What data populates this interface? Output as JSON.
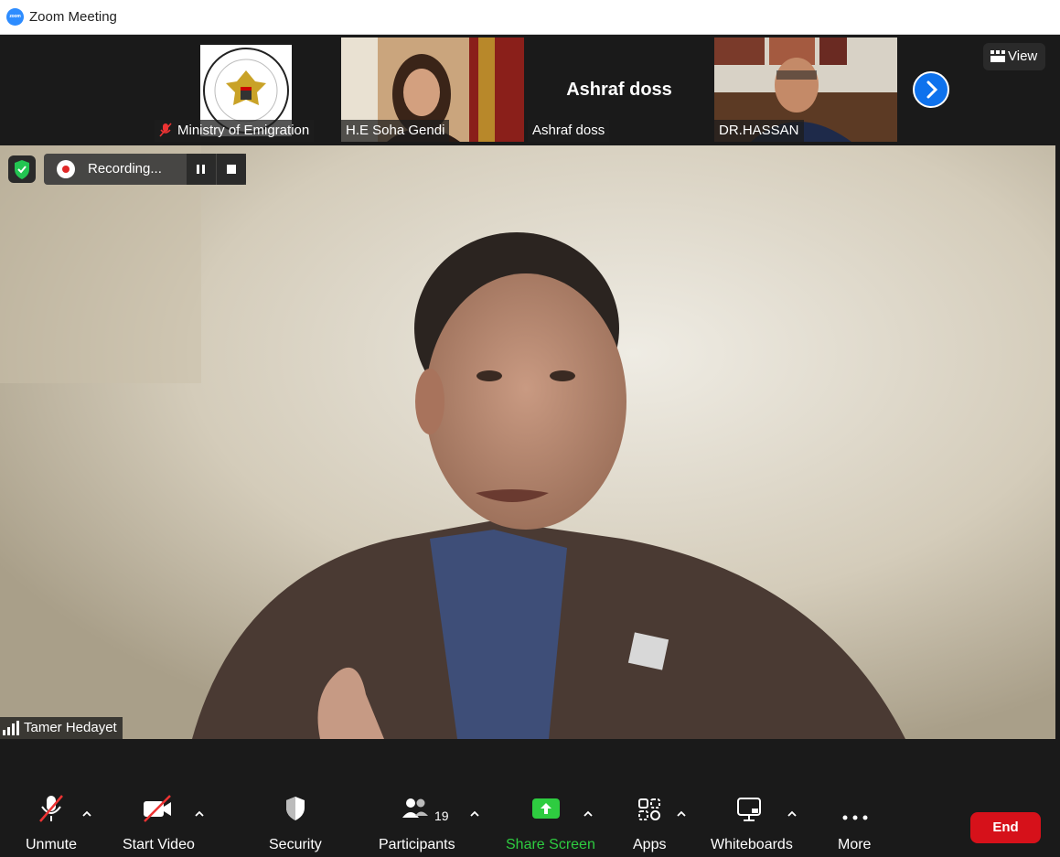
{
  "window": {
    "title": "Zoom Meeting",
    "logo_text": "zoom"
  },
  "top_bar": {
    "view_label": "View"
  },
  "participants_strip": [
    {
      "name": "Ministry of Emigration",
      "muted": true
    },
    {
      "name": "H.E Soha Gendi",
      "muted": false
    },
    {
      "name": "Ashraf doss",
      "display_name": "Ashraf doss",
      "muted": false
    },
    {
      "name": "DR.HASSAN",
      "muted": false
    }
  ],
  "recording": {
    "label": "Recording..."
  },
  "active_speaker": {
    "name": "Tamer Hedayet"
  },
  "toolbar": {
    "unmute": "Unmute",
    "start_video": "Start Video",
    "security": "Security",
    "participants": "Participants",
    "participants_count": "19",
    "share_screen": "Share Screen",
    "apps": "Apps",
    "whiteboards": "Whiteboards",
    "more": "More",
    "end": "End"
  },
  "colors": {
    "share_green": "#2ecc40",
    "end_red": "#d6111a",
    "accent_blue": "#0e72ed"
  }
}
